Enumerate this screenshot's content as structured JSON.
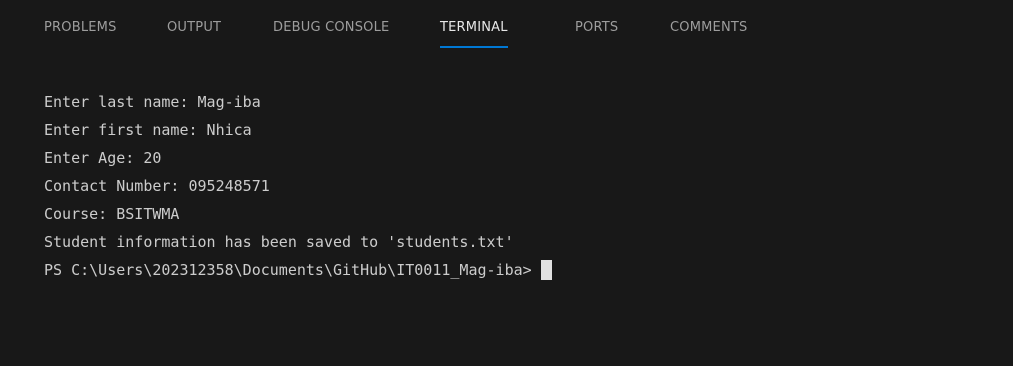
{
  "tabs": [
    {
      "label": "PROBLEMS",
      "active": false
    },
    {
      "label": "OUTPUT",
      "active": false
    },
    {
      "label": "DEBUG CONSOLE",
      "active": false
    },
    {
      "label": "TERMINAL",
      "active": true
    },
    {
      "label": "PORTS",
      "active": false
    },
    {
      "label": "COMMENTS",
      "active": false
    }
  ],
  "terminal": {
    "lines": [
      "Enter last name: Mag-iba",
      "Enter first name: Nhica",
      "Enter Age: 20",
      "Contact Number: 095248571",
      "Course: BSITWMA",
      "Student information has been saved to 'students.txt'"
    ],
    "prompt": "PS C:\\Users\\202312358\\Documents\\GitHub\\IT0011_Mag-iba>"
  },
  "colors": {
    "background": "#181818",
    "active_tab_underline": "#0078d4",
    "text": "#cccccc",
    "inactive_tab_text": "#9d9d9d"
  }
}
